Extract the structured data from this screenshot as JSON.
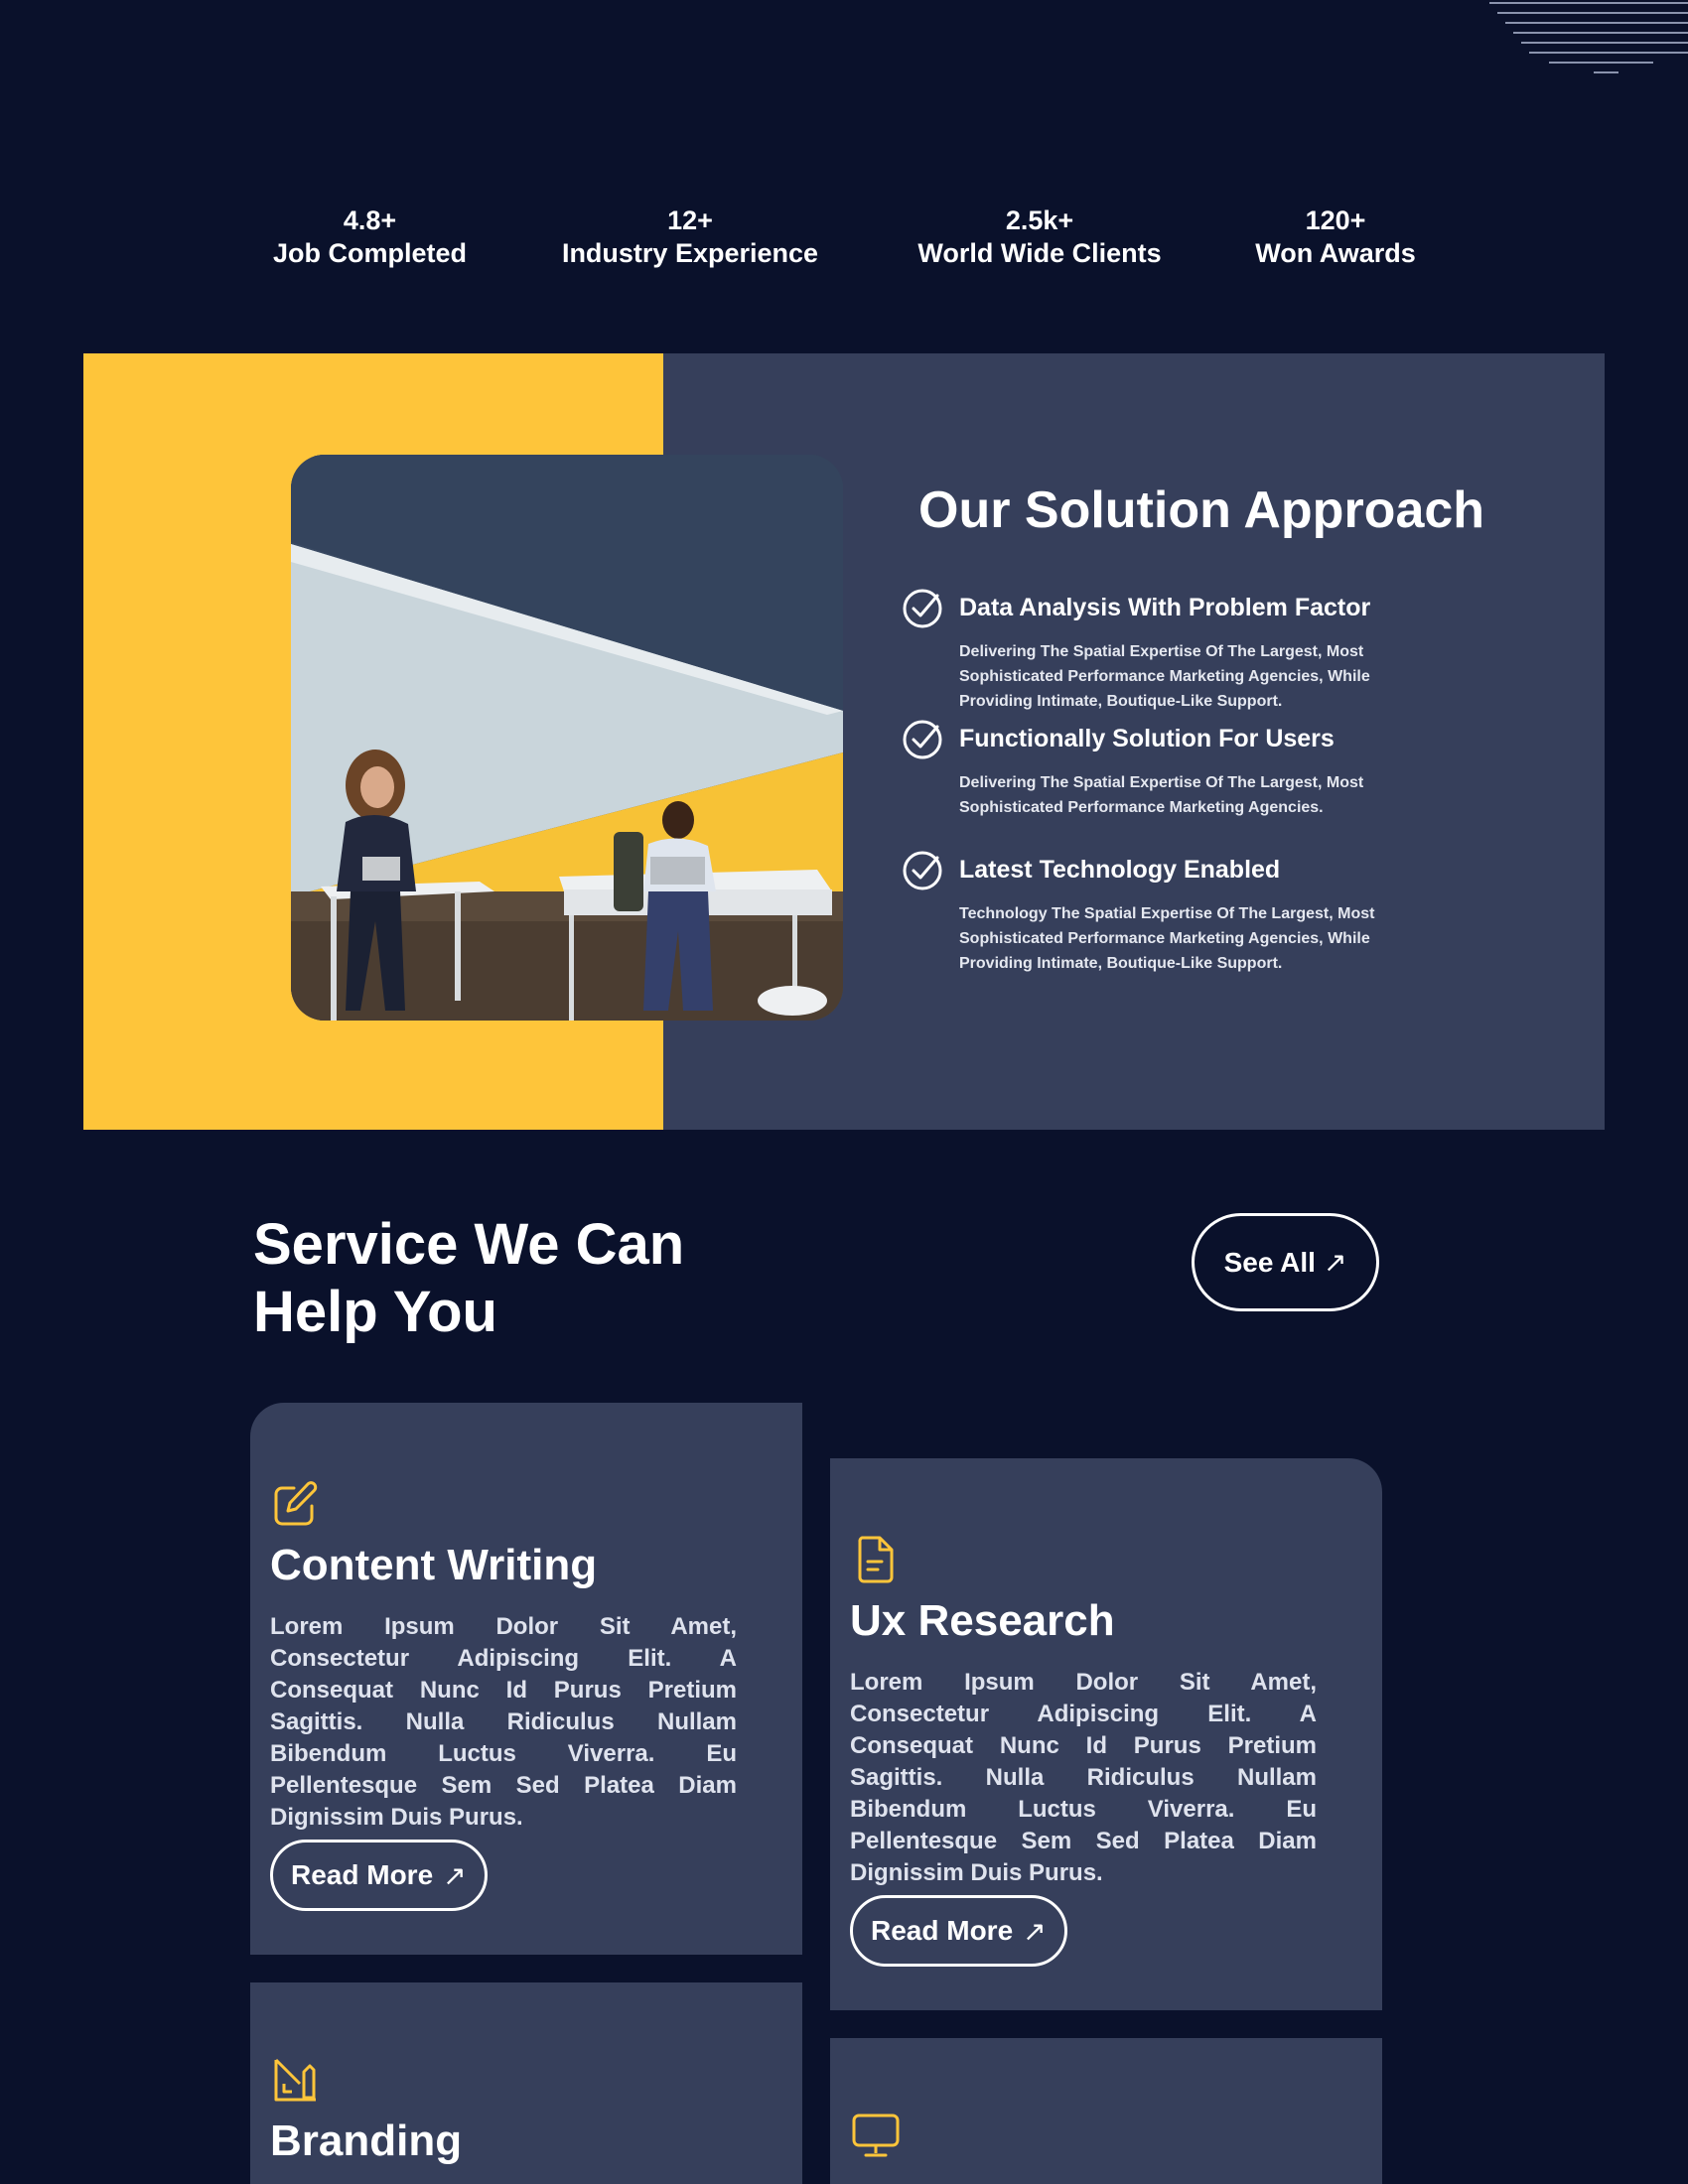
{
  "stats": [
    {
      "value": "4.8+",
      "label": "Job Completed"
    },
    {
      "value": "12+",
      "label": "Industry Experience"
    },
    {
      "value": "2.5k+",
      "label": "World Wide Clients"
    },
    {
      "value": "120+",
      "label": "Won Awards"
    }
  ],
  "solution": {
    "title": "Our Solution Approach",
    "items": [
      {
        "heading": "Data Analysis With Problem Factor",
        "text": "Delivering The Spatial Expertise Of The Largest, Most Sophisticated Performance Marketing Agencies, While Providing Intimate, Boutique-Like Support."
      },
      {
        "heading": "Functionally Solution For Users",
        "text": "Delivering The Spatial Expertise Of The Largest, Most Sophisticated Performance Marketing Agencies."
      },
      {
        "heading": "Latest Technology Enabled",
        "text": "Technology The Spatial Expertise Of The Largest, Most Sophisticated Performance Marketing Agencies, While Providing Intimate, Boutique-Like Support."
      }
    ]
  },
  "services": {
    "title": "Service We Can Help You",
    "see_all_label": "See All",
    "read_more_label": "Read More",
    "arrow_glyph": "↗",
    "cards": [
      {
        "title": "Content Writing",
        "icon": "edit-icon",
        "text": "Lorem Ipsum Dolor Sit Amet, Consectetur Adipiscing Elit. A Consequat Nunc Id Purus Pretium Sagittis. Nulla Ridiculus Nullam Bibendum Luctus Viverra. Eu Pellentesque Sem Sed Platea Diam Dignissim Duis Purus."
      },
      {
        "title": "Ux Research",
        "icon": "document-icon",
        "text": "Lorem Ipsum Dolor Sit Amet, Consectetur Adipiscing Elit. A Consequat Nunc Id Purus Pretium Sagittis. Nulla Ridiculus Nullam Bibendum Luctus Viverra. Eu Pellentesque Sem Sed Platea Diam Dignissim Duis Purus."
      },
      {
        "title": "Branding",
        "icon": "design-tools-icon"
      },
      {
        "icon": "monitor-icon"
      }
    ]
  },
  "colors": {
    "background": "#0a112b",
    "panel": "#363f5b",
    "accent_yellow": "#fec53a",
    "text": "#ffffff"
  }
}
